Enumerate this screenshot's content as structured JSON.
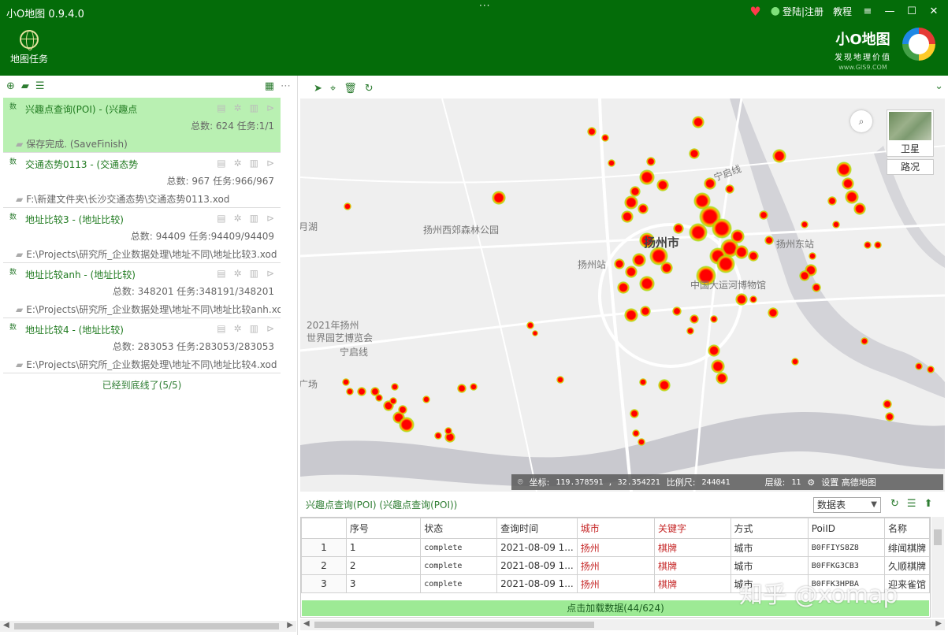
{
  "app": {
    "title": "小O地图 0.9.4.0",
    "drag_handle": "···",
    "login": "登陆|注册",
    "tutorial": "教程"
  },
  "header": {
    "task_button_label": "地图任务",
    "brand_name": "小O地图",
    "brand_slogan": "发现地理价值",
    "brand_site": "www.GIS9.COM"
  },
  "tasks": [
    {
      "tag": "数",
      "title": "兴趣点查询(POI) - (兴趣点",
      "counts": "总数: 624 任务:1/1",
      "path": "保存完成. (SaveFinish)",
      "active": true
    },
    {
      "tag": "数",
      "title": "交通态势0113 - (交通态势",
      "counts": "总数: 967 任务:966/967",
      "path": "F:\\新建文件夹\\长沙交通态势\\交通态势0113.xod"
    },
    {
      "tag": "数",
      "title": "地址比较3 - (地址比较)",
      "counts": "总数: 94409 任务:94409/94409",
      "path": "E:\\Projects\\研究所_企业数据处理\\地址不同\\地址比较3.xod"
    },
    {
      "tag": "数",
      "title": "地址比较anh - (地址比较)",
      "counts": "总数: 348201 任务:348191/348201",
      "path": "E:\\Projects\\研究所_企业数据处理\\地址不同\\地址比较anh.xod"
    },
    {
      "tag": "数",
      "title": "地址比较4 - (地址比较)",
      "counts": "总数: 283053 任务:283053/283053",
      "path": "E:\\Projects\\研究所_企业数据处理\\地址不同\\地址比较4.xod"
    }
  ],
  "task_list_end": "已经到底线了(5/5)",
  "map": {
    "labels": {
      "city": "扬州市",
      "park": "扬州西郊森林公园",
      "lake": "月湖",
      "station": "扬州站",
      "east_station": "扬州东站",
      "museum": "中国大运河博物馆",
      "expo": "2021年扬州",
      "expo2": "世界园艺博览会",
      "ningqi": "宁启线",
      "square": "广场",
      "road": "宁启线"
    },
    "satellite_label": "卫星",
    "traffic_label": "路况",
    "status": {
      "coord_label": "坐标:",
      "coord_value": "119.378591 , 32.354221",
      "scale_label": "比例尺:",
      "scale_value": "244041",
      "level_label": "层级:",
      "level_value": "11",
      "settings": "设置 高德地图"
    }
  },
  "data_panel": {
    "title": "兴趣点查询(POI) (兴趣点查询(POI))",
    "view_select": "数据表",
    "columns": [
      "序号",
      "状态",
      "查询时间",
      "城市",
      "关键字",
      "方式",
      "PoiID",
      "名称"
    ],
    "rows": [
      {
        "idx": "1",
        "seq": "1",
        "status": "complete",
        "time": "2021-08-09 1...",
        "city": "扬州",
        "keyword": "棋牌",
        "mode": "城市",
        "poi": "B0FFIYS8Z8",
        "name": "绯闻棋牌"
      },
      {
        "idx": "2",
        "seq": "2",
        "status": "complete",
        "time": "2021-08-09 1...",
        "city": "扬州",
        "keyword": "棋牌",
        "mode": "城市",
        "poi": "B0FFKG3CB3",
        "name": "久顺棋牌"
      },
      {
        "idx": "3",
        "seq": "3",
        "status": "complete",
        "time": "2021-08-09 1...",
        "city": "扬州",
        "keyword": "棋牌",
        "mode": "城市",
        "poi": "B0FFK3HPBA",
        "name": "迎来雀馆"
      }
    ],
    "load_more": "点击加载数据(44/624)"
  },
  "watermark": "知乎 @xomap",
  "colors": {
    "header": "#046c09",
    "active_task": "#b9f0b2",
    "accent": "#2e7d32",
    "highlight": "#c62828"
  }
}
